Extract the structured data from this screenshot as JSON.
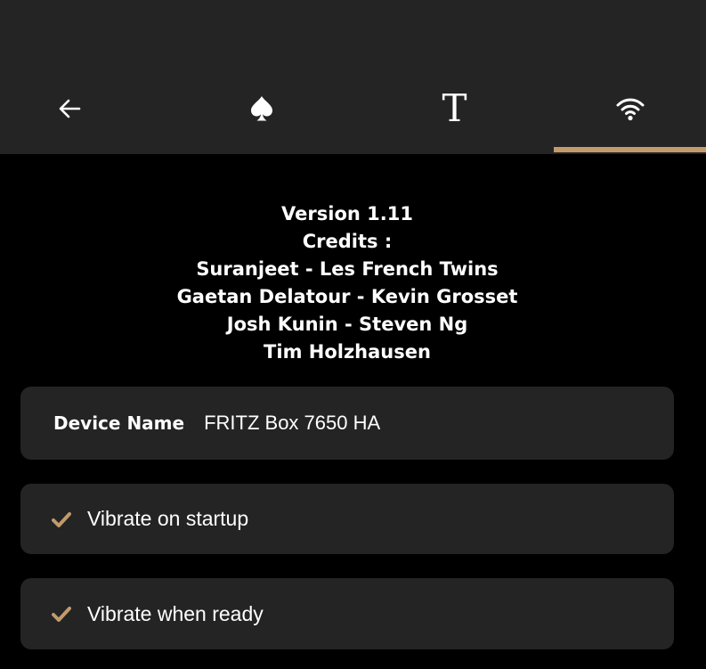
{
  "tabs": {
    "items": [
      {
        "icon": "arrow-left-icon"
      },
      {
        "icon": "spade-icon"
      },
      {
        "icon": "text-t-icon",
        "glyph": "T"
      },
      {
        "icon": "wifi-icon"
      }
    ],
    "selected_index": 3
  },
  "credits": {
    "lines": [
      "Version 1.11",
      "Credits :",
      "Suranjeet - Les French Twins",
      "Gaetan Delatour - Kevin Grosset",
      "Josh Kunin - Steven Ng",
      "Tim Holzhausen"
    ]
  },
  "device": {
    "label": "Device Name",
    "value": "FRITZ Box 7650 HA"
  },
  "options": [
    {
      "label": "Vibrate on startup",
      "checked": true,
      "icon": "check-icon"
    },
    {
      "label": "Vibrate when ready",
      "checked": true,
      "icon": "check-icon"
    }
  ],
  "colors": {
    "background": "#000000",
    "surface": "#242424",
    "accent": "#c29a6b",
    "text": "#ffffff"
  }
}
